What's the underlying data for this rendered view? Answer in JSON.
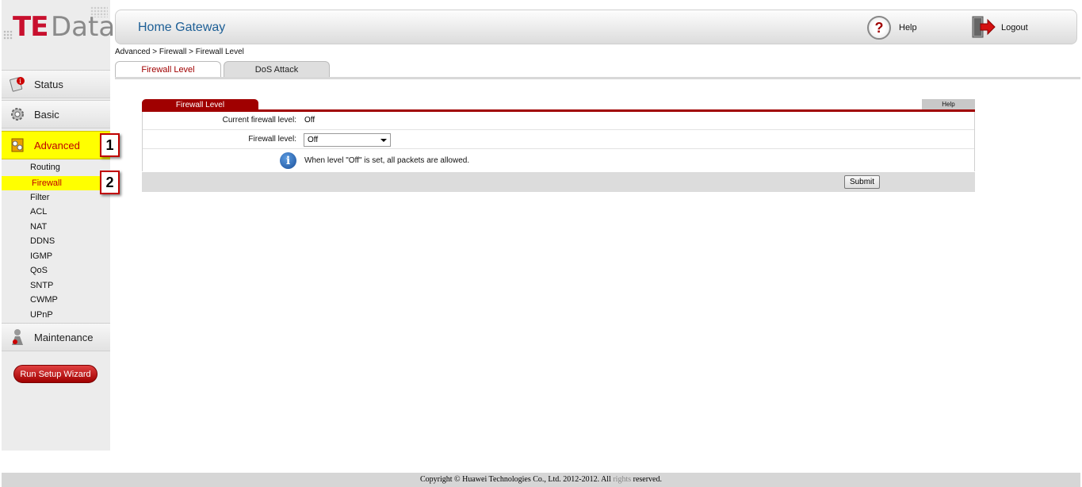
{
  "logo": {
    "te": "TE",
    "data": "Data"
  },
  "header": {
    "title": "Home Gateway",
    "help": "Help",
    "logout": "Logout"
  },
  "breadcrumb": "Advanced > Firewall > Firewall Level",
  "tabs": [
    {
      "label": "Firewall Level",
      "active": true
    },
    {
      "label": "DoS Attack",
      "active": false
    }
  ],
  "sidebar": {
    "main": [
      {
        "label": "Status",
        "icon": "status-icon"
      },
      {
        "label": "Basic",
        "icon": "gear-icon"
      },
      {
        "label": "Advanced",
        "icon": "advanced-icon",
        "active": true
      },
      {
        "label": "Maintenance",
        "icon": "maintenance-icon"
      }
    ],
    "sub": [
      "Routing",
      "Firewall",
      "Filter",
      "ACL",
      "NAT",
      "DDNS",
      "IGMP",
      "QoS",
      "SNTP",
      "CWMP",
      "UPnP"
    ],
    "wizard": "Run Setup Wizard"
  },
  "annotations": [
    "1",
    "2"
  ],
  "panel": {
    "tab": "Firewall Level",
    "help": "Help",
    "current_label": "Current firewall level:",
    "current_value": "Off",
    "level_label": "Firewall level:",
    "level_value": "Off",
    "info": "When level \"Off\" is set, all packets are allowed.",
    "submit": "Submit"
  },
  "footer": {
    "text": "Copyright © Huawei Technologies Co., Ltd. 2012-2012. All",
    "rights": "rights",
    "reserved": "reserved."
  },
  "colors": {
    "brand_red": "#c8102e",
    "highlight": "#ffff00",
    "accent_red": "#a00000",
    "header_blue": "#1d5f96"
  }
}
